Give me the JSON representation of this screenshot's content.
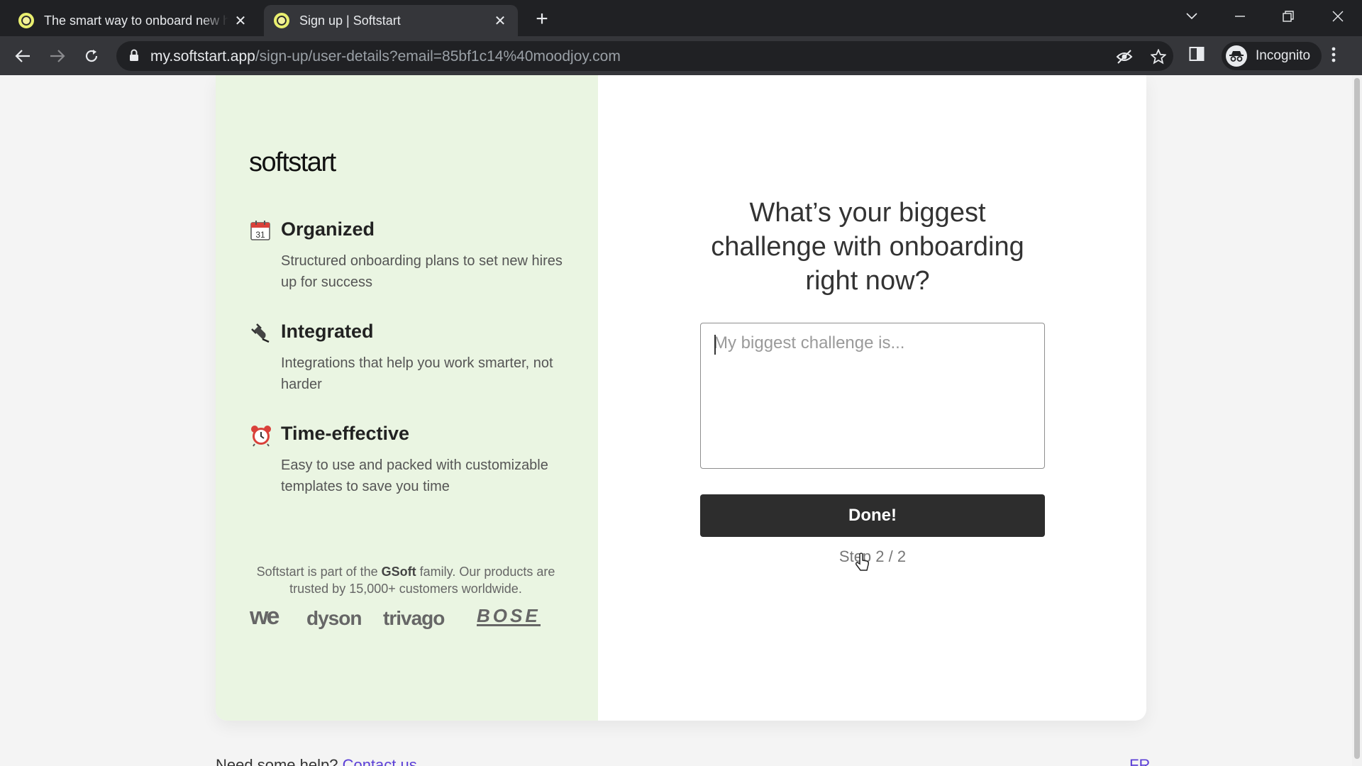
{
  "browser": {
    "tabs": [
      {
        "title": "The smart way to onboard new hires",
        "active": false
      },
      {
        "title": "Sign up | Softstart",
        "active": true
      }
    ],
    "new_tab_icon": "plus-icon",
    "url_host": "my.softstart.app",
    "url_path": "/sign-up/user-details?email=85bf1c14%40moodjoy.com",
    "profile_label": "Incognito"
  },
  "page": {
    "logo": "softstart",
    "features": [
      {
        "icon": "calendar-icon",
        "calendar_day": "31",
        "title": "Organized",
        "description": "Structured onboarding plans to set new hires up for success"
      },
      {
        "icon": "plug-icon",
        "title": "Integrated",
        "description": "Integrations that help you work smarter, not harder"
      },
      {
        "icon": "alarm-clock-icon",
        "title": "Time-effective",
        "description": "Easy to use and packed with customizable templates to save you time"
      }
    ],
    "family_pre": "Softstart is part of the ",
    "family_brand": "GSoft",
    "family_post": " family. Our products are trusted by 15,000+ customers worldwide.",
    "brands": [
      "we",
      "dyson",
      "trivago",
      "BOSE"
    ],
    "question": "What’s your biggest challenge with onboarding right now?",
    "answer_placeholder": "My biggest challenge is...",
    "answer_value": "",
    "submit_label": "Done!",
    "step_label": "Step 2 / 2",
    "help_text": "Need some help?",
    "help_link": "Contact us",
    "lang_toggle": "FR"
  },
  "colors": {
    "left_panel_bg": "#eaf5e2",
    "button_bg": "#2d2d2d",
    "link": "#5b3fd6"
  }
}
